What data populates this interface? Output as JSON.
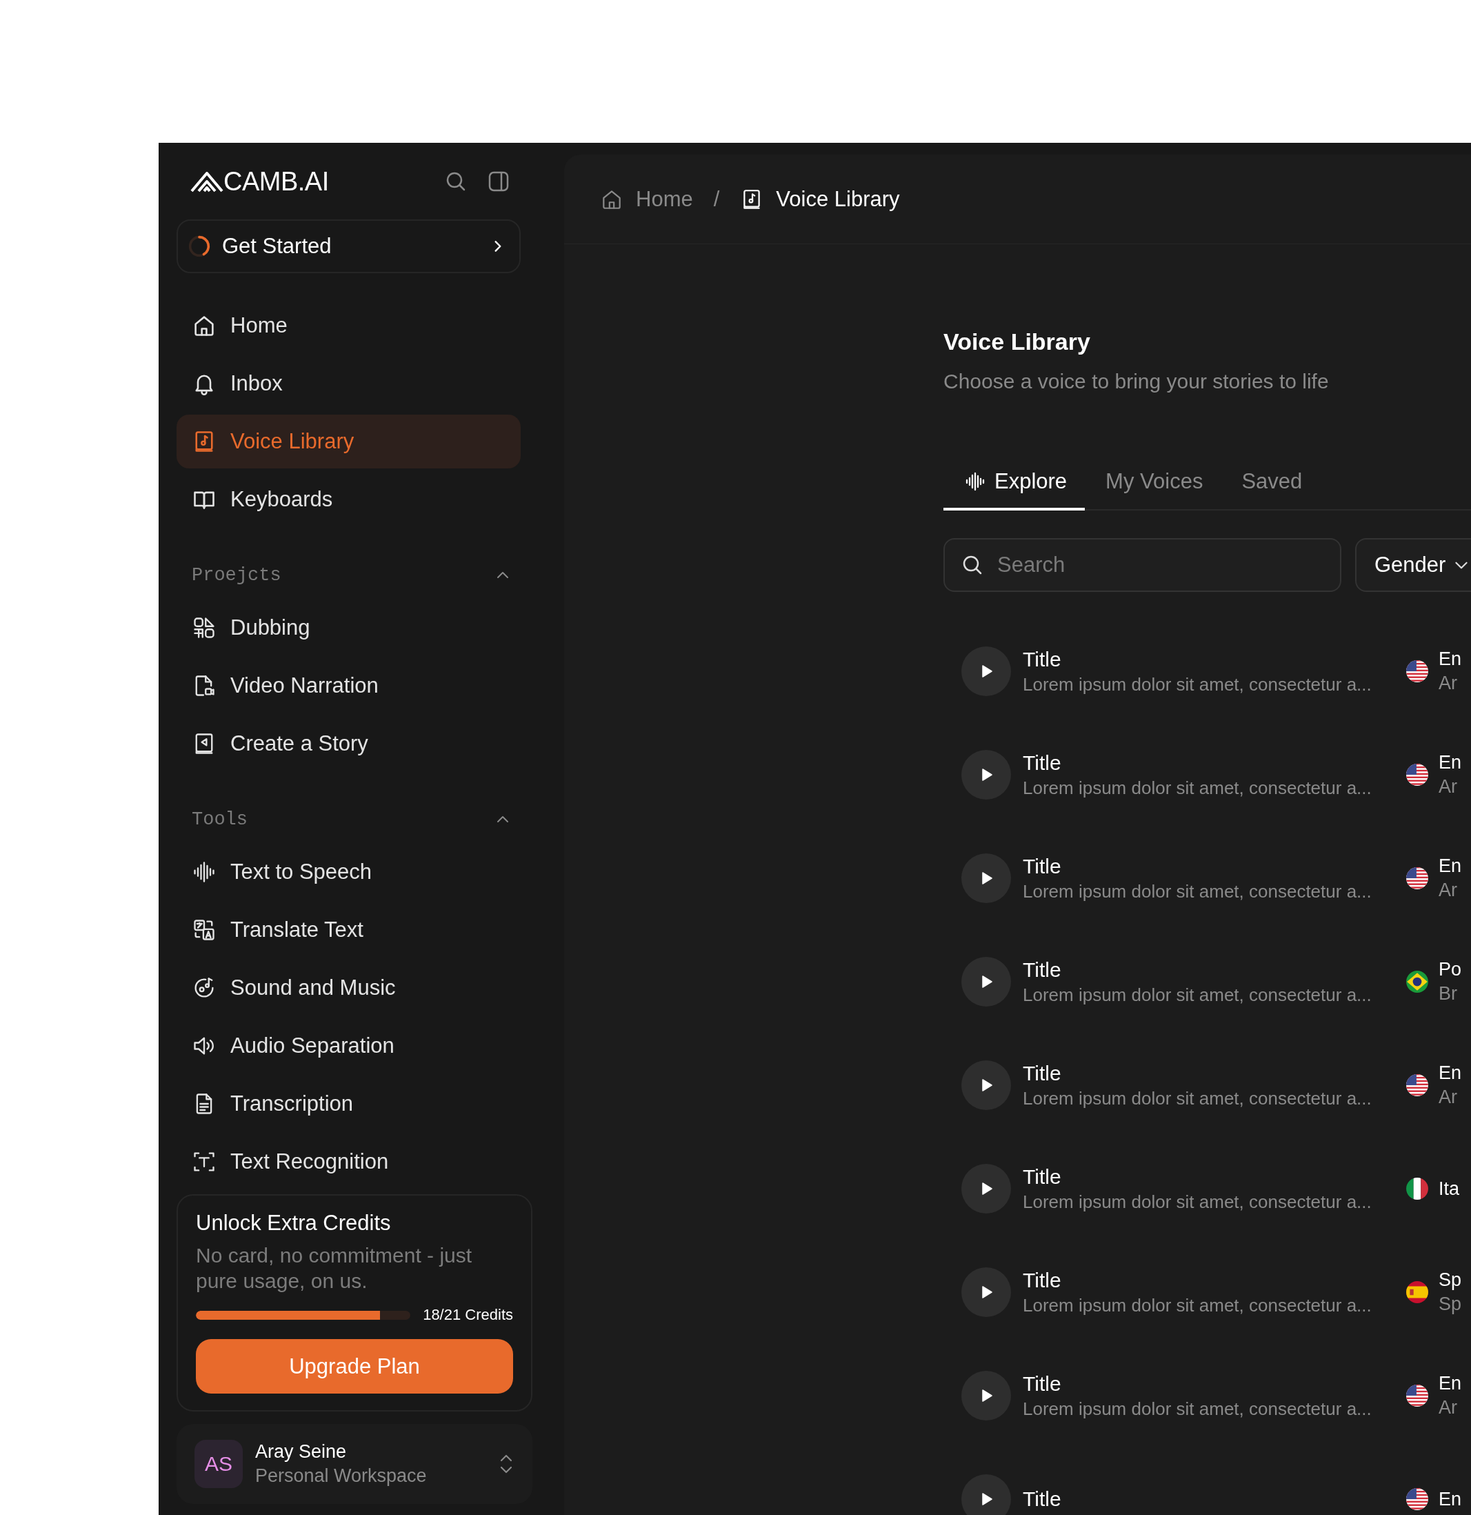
{
  "sidebar": {
    "logo": "CAMB.AI",
    "get_started": {
      "label": "Get Started",
      "level": 0.42
    },
    "items": [
      {
        "label": "Home",
        "selected": false
      },
      {
        "label": "Inbox",
        "selected": false
      },
      {
        "label": "Voice Library",
        "selected": true
      },
      {
        "label": "Keyboards",
        "selected": false
      }
    ],
    "groups": [
      {
        "title": "Proejcts",
        "expanded": true,
        "items": [
          {
            "label": "Dubbing",
            "selected": false
          },
          {
            "label": "Video Narration",
            "selected": false
          },
          {
            "label": "Create a Story",
            "selected": false
          }
        ]
      },
      {
        "title": "Tools",
        "expanded": true,
        "items": [
          {
            "label": "Text to Speech",
            "selected": false
          },
          {
            "label": "Translate Text",
            "selected": false
          },
          {
            "label": "Sound and Music",
            "selected": false
          },
          {
            "label": "Audio Separation",
            "selected": false
          },
          {
            "label": "Transcription",
            "selected": false
          },
          {
            "label": "Text Recognition",
            "selected": false
          }
        ]
      }
    ],
    "credits": {
      "title": "Unlock Extra Credits",
      "text": "No card, no commitment - just pure usage, on us.",
      "level": 0.857,
      "reading": "18/21 Credits",
      "button": "Upgrade Plan"
    },
    "user": {
      "initials": "AS",
      "name": "Aray Seine",
      "workspace": "Personal Workspace"
    }
  },
  "breadcrumb": {
    "separator": "/",
    "items": [
      {
        "label": "Home",
        "current": false
      },
      {
        "label": "Voice Library",
        "current": true
      }
    ]
  },
  "page": {
    "title": "Voice Library",
    "subtitle": "Choose a voice to bring your stories to life"
  },
  "tabs": [
    {
      "label": "Explore",
      "selected": true
    },
    {
      "label": "My Voices",
      "selected": false
    },
    {
      "label": "Saved",
      "selected": false
    }
  ],
  "search": {
    "placeholder": "Search"
  },
  "filter": {
    "label": "Gender"
  },
  "voices": [
    {
      "kind": "us",
      "title": "Title",
      "description": "Lorem ipsum dolor sit amet, consectetur a...",
      "language": "En",
      "accent": "Ar"
    },
    {
      "kind": "us",
      "title": "Title",
      "description": "Lorem ipsum dolor sit amet, consectetur a...",
      "language": "En",
      "accent": "Ar"
    },
    {
      "kind": "us",
      "title": "Title",
      "description": "Lorem ipsum dolor sit amet, consectetur a...",
      "language": "En",
      "accent": "Ar"
    },
    {
      "kind": "br",
      "title": "Title",
      "description": "Lorem ipsum dolor sit amet, consectetur a...",
      "language": "Po",
      "accent": "Br"
    },
    {
      "kind": "us",
      "title": "Title",
      "description": "Lorem ipsum dolor sit amet, consectetur a...",
      "language": "En",
      "accent": "Ar"
    },
    {
      "kind": "it",
      "title": "Title",
      "description": "Lorem ipsum dolor sit amet, consectetur a...",
      "language": "Ita"
    },
    {
      "kind": "es",
      "title": "Title",
      "description": "Lorem ipsum dolor sit amet, consectetur a...",
      "language": "Sp",
      "accent": "Sp"
    },
    {
      "kind": "us",
      "title": "Title",
      "description": "Lorem ipsum dolor sit amet, consectetur a...",
      "language": "En",
      "accent": "Ar"
    },
    {
      "kind": "us",
      "title": "Title",
      "language": "En"
    }
  ]
}
